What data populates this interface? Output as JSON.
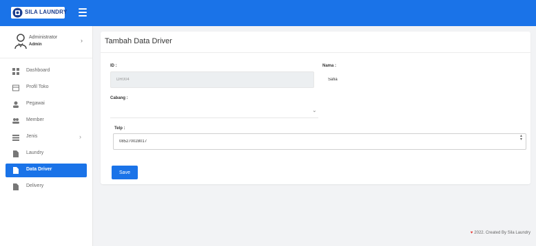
{
  "brand": {
    "name": "SILA LAUNDRY"
  },
  "user": {
    "name": "Administrator",
    "role": "Admin"
  },
  "sidebar": {
    "items": [
      {
        "label": "Dashboard",
        "icon": "dashboard-icon"
      },
      {
        "label": "Profil Toko",
        "icon": "store-icon"
      },
      {
        "label": "Pegawai",
        "icon": "user-icon"
      },
      {
        "label": "Member",
        "icon": "users-icon"
      },
      {
        "label": "Jenis",
        "icon": "list-icon"
      },
      {
        "label": "Laundry",
        "icon": "file-icon"
      },
      {
        "label": "Data Driver",
        "icon": "file-icon"
      },
      {
        "label": "Delivery",
        "icon": "file-icon"
      }
    ]
  },
  "page": {
    "title": "Tambah Data Driver"
  },
  "form": {
    "id_label": "ID :",
    "id_value": "DR004",
    "nama_label": "Nama :",
    "nama_value": "Safia",
    "cabang_label": "Cabang :",
    "cabang_value": "",
    "telp_label": "Telp :",
    "telp_value": "085270028017",
    "save_label": "Save"
  },
  "footer": {
    "text": "2022. Created By Sila Laundry"
  },
  "colors": {
    "accent": "#1a73e8",
    "heart": "#e53935"
  }
}
